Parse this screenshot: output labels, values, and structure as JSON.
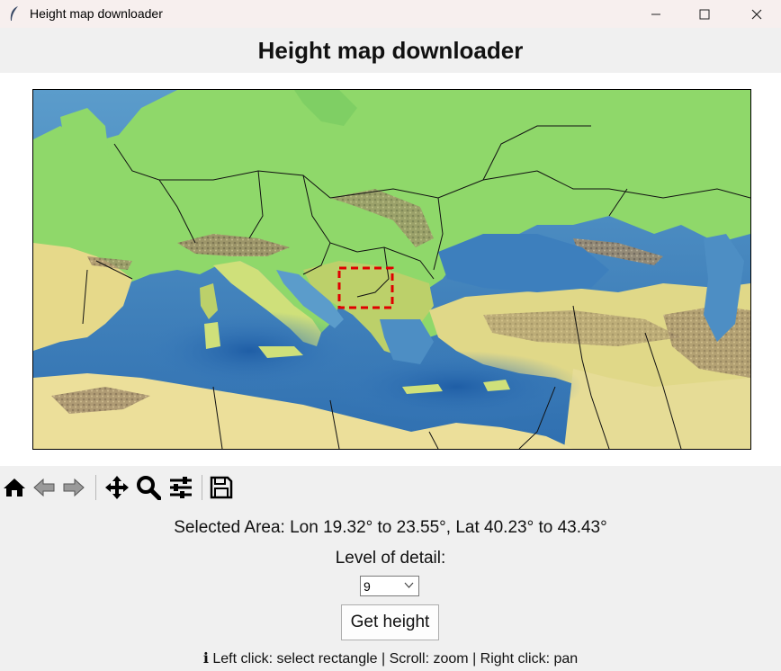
{
  "window": {
    "title": "Height map downloader",
    "icon": "feather-icon",
    "controls": [
      "minimize-icon",
      "maximize-icon",
      "close-icon"
    ]
  },
  "header": {
    "title": "Height map downloader"
  },
  "map": {
    "description_icon": "terrain-map",
    "selection_color": "#e00000",
    "selected_area": {
      "lon_min": 19.32,
      "lon_max": 23.55,
      "lat_min": 40.23,
      "lat_max": 43.43
    }
  },
  "toolbar": {
    "buttons": [
      "home-icon",
      "back-arrow-icon",
      "forward-arrow-icon",
      "pan-icon",
      "zoom-icon",
      "configure-subplots-icon",
      "save-icon"
    ]
  },
  "selection": {
    "text": "Selected Area: Lon 19.32° to 23.55°, Lat 40.23° to 43.43°"
  },
  "detail": {
    "label": "Level of detail:",
    "selected_value": "9"
  },
  "action": {
    "get_height_label": "Get height"
  },
  "hint": {
    "icon": "info-icon",
    "glyph": "ℹ",
    "text": " Left click: select rectangle | Scroll: zoom | Right click: pan"
  }
}
